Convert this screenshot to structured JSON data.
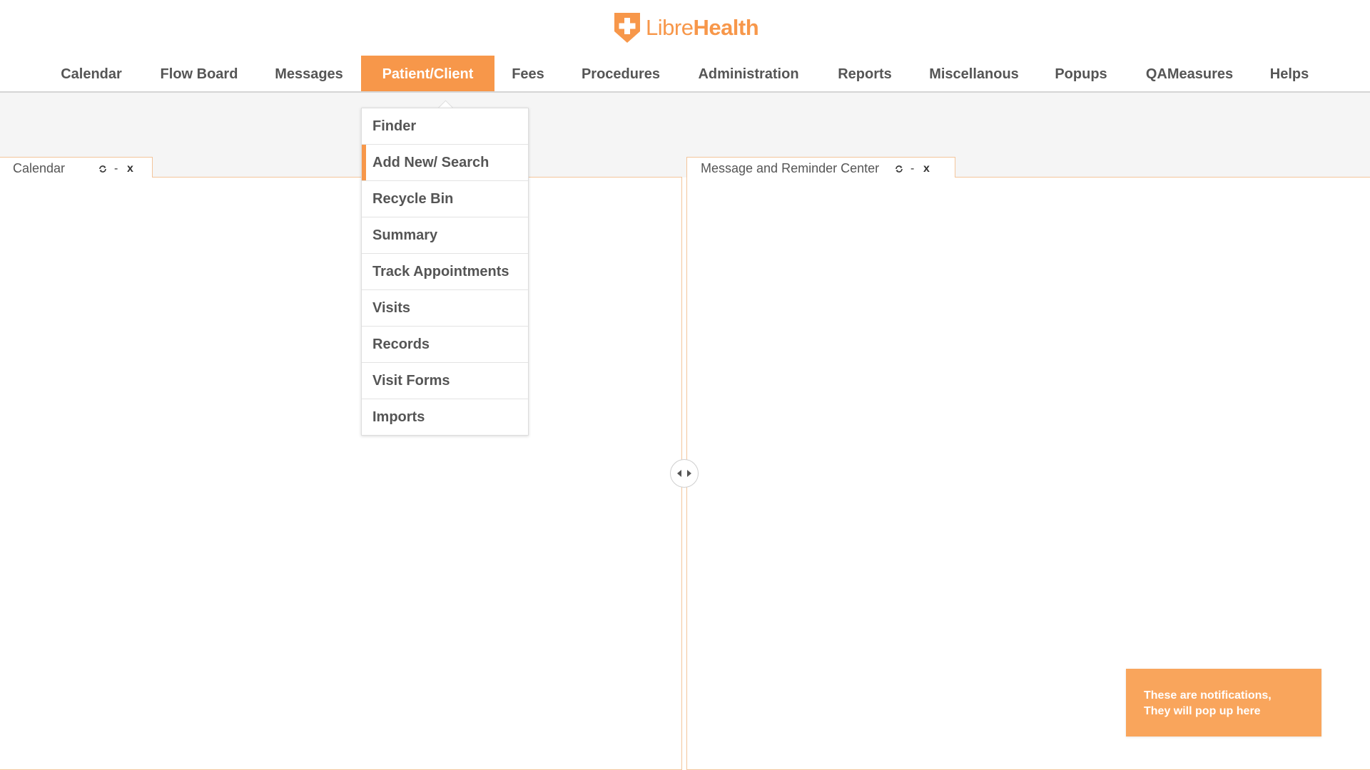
{
  "brand": {
    "name_light": "Libre",
    "name_bold": "Health",
    "color": "#f7974a"
  },
  "nav": {
    "items": [
      {
        "label": "Calendar"
      },
      {
        "label": "Flow Board"
      },
      {
        "label": "Messages"
      },
      {
        "label": "Patient/Client",
        "active": true
      },
      {
        "label": "Fees"
      },
      {
        "label": "Procedures"
      },
      {
        "label": "Administration"
      },
      {
        "label": "Reports"
      },
      {
        "label": "Miscellanous"
      },
      {
        "label": "Popups"
      },
      {
        "label": "QAMeasures"
      },
      {
        "label": "Helps"
      }
    ],
    "active_color": "#f7974a"
  },
  "dropdown": {
    "items": [
      {
        "label": "Finder"
      },
      {
        "label": "Add New/ Search",
        "active": true
      },
      {
        "label": "Recycle Bin"
      },
      {
        "label": "Summary"
      },
      {
        "label": "Track Appointments"
      },
      {
        "label": "Visits"
      },
      {
        "label": "Records"
      },
      {
        "label": "Visit Forms"
      },
      {
        "label": "Imports"
      }
    ]
  },
  "panes": {
    "left": {
      "title": "Calendar",
      "refresh_icon": "refresh-icon",
      "minimize_label": "-",
      "close_label": "x"
    },
    "right": {
      "title": "Message and Reminder Center",
      "refresh_icon": "refresh-icon",
      "minimize_label": "-",
      "close_label": "x"
    }
  },
  "splitter": {
    "icon": "resize-arrows-icon"
  },
  "notification": {
    "line1": "These are notifications,",
    "line2": "They will pop up here",
    "color": "#f9a55c"
  }
}
